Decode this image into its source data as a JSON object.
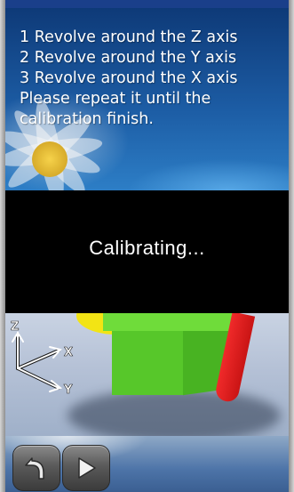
{
  "instructions": {
    "lines": [
      "1 Revolve around the Z axis",
      "2 Revolve around the Y axis",
      "3 Revolve around the X axis",
      "Please repeat it until the",
      "calibration finish."
    ]
  },
  "status": {
    "text": "Calibrating..."
  },
  "axis_indicator": {
    "z_label": "Z",
    "x_label": "X",
    "y_label": "Y"
  },
  "controls": {
    "back_icon": "back-arrow-icon",
    "play_icon": "play-icon"
  },
  "colors": {
    "status_background": "#000000",
    "status_text": "#ffffff",
    "cube": "#57c72a",
    "ribbon": "#e02020",
    "yellow_piece": "#f2e414"
  }
}
